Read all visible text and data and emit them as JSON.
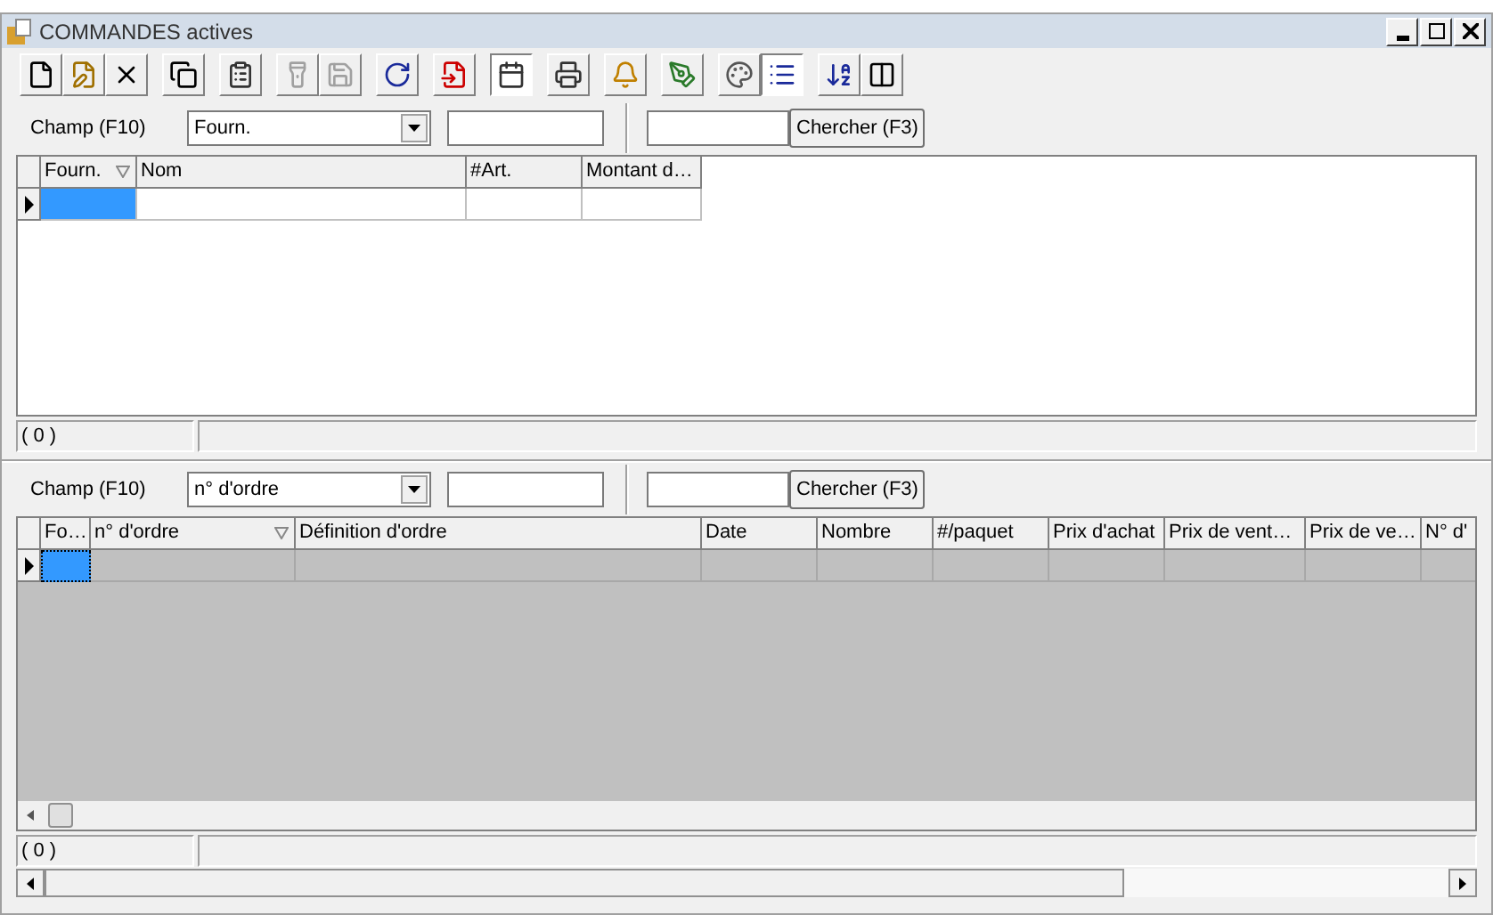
{
  "window": {
    "title": "COMMANDES actives"
  },
  "toolbar_groups": [
    [
      {
        "disabled": false,
        "pressed": false
      },
      {
        "disabled": false,
        "pressed": false
      },
      {
        "disabled": false,
        "pressed": false
      }
    ],
    [
      {
        "disabled": false,
        "pressed": false
      }
    ],
    [
      {
        "disabled": false,
        "pressed": false
      }
    ],
    [
      {
        "disabled": true,
        "pressed": false
      },
      {
        "disabled": true,
        "pressed": false
      }
    ],
    [
      {
        "disabled": false,
        "pressed": false
      }
    ],
    [
      {
        "disabled": false,
        "pressed": false
      }
    ],
    [
      {
        "disabled": false,
        "pressed": true
      }
    ],
    [
      {
        "disabled": false,
        "pressed": false
      }
    ],
    [
      {
        "disabled": false,
        "pressed": false
      }
    ],
    [
      {
        "disabled": false,
        "pressed": false
      }
    ],
    [
      {
        "disabled": false,
        "pressed": false
      },
      {
        "disabled": false,
        "pressed": true
      }
    ],
    [
      {
        "disabled": false,
        "pressed": false
      },
      {
        "disabled": false,
        "pressed": false
      }
    ]
  ],
  "panels": [
    {
      "field_label": "Champ (F10)",
      "field_value": "Fourn.",
      "search_button": "Chercher (F3)",
      "kind": "white",
      "columns": [
        {
          "label": "Fourn.",
          "sorted": true
        },
        {
          "label": "Nom",
          "sorted": false
        },
        {
          "label": "#Art.",
          "sorted": false
        },
        {
          "label": "Montant d…",
          "sorted": false
        }
      ],
      "status": "( 0 )",
      "hscroll": false
    },
    {
      "field_label": "Champ (F10)",
      "field_value": "n° d'ordre",
      "search_button": "Chercher (F3)",
      "kind": "grey",
      "columns": [
        {
          "label": "Fo…",
          "sorted": false
        },
        {
          "label": "n° d'ordre",
          "sorted": true
        },
        {
          "label": "Définition d'ordre",
          "sorted": false
        },
        {
          "label": "Date",
          "sorted": false
        },
        {
          "label": "Nombre",
          "sorted": false
        },
        {
          "label": "#/paquet",
          "sorted": false
        },
        {
          "label": "Prix d'achat",
          "sorted": false
        },
        {
          "label": "Prix de vent…",
          "sorted": false
        },
        {
          "label": "Prix de ve…",
          "sorted": false
        },
        {
          "label": "N° d'",
          "sorted": false
        }
      ],
      "status": "( 0 )",
      "hscroll": true
    }
  ]
}
